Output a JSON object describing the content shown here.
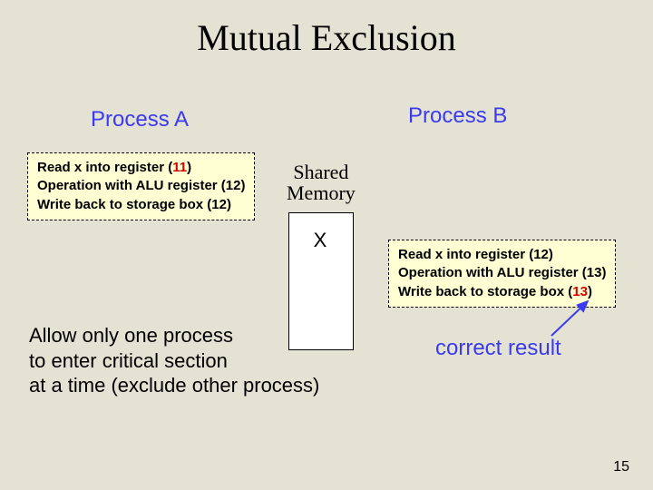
{
  "title": "Mutual Exclusion",
  "processA": {
    "label": "Process A",
    "line1_pre": "Read x into register (",
    "line1_val": "11",
    "line1_post": ")",
    "line2": "Operation with ALU register (12)",
    "line3": "Write back to storage box (12)"
  },
  "processB": {
    "label": "Process B",
    "line1": "Read x into register (12)",
    "line2": "Operation with ALU register (13)",
    "line3_pre": "Write back to storage box (",
    "line3_val": "13",
    "line3_post": ")"
  },
  "shared": {
    "label_l1": "Shared",
    "label_l2": "Memory",
    "x": "X"
  },
  "note": {
    "l1": "Allow only one process",
    "l2": "to enter critical section",
    "l3": "at a time (exclude other process)"
  },
  "result": "correct result",
  "page": "15"
}
